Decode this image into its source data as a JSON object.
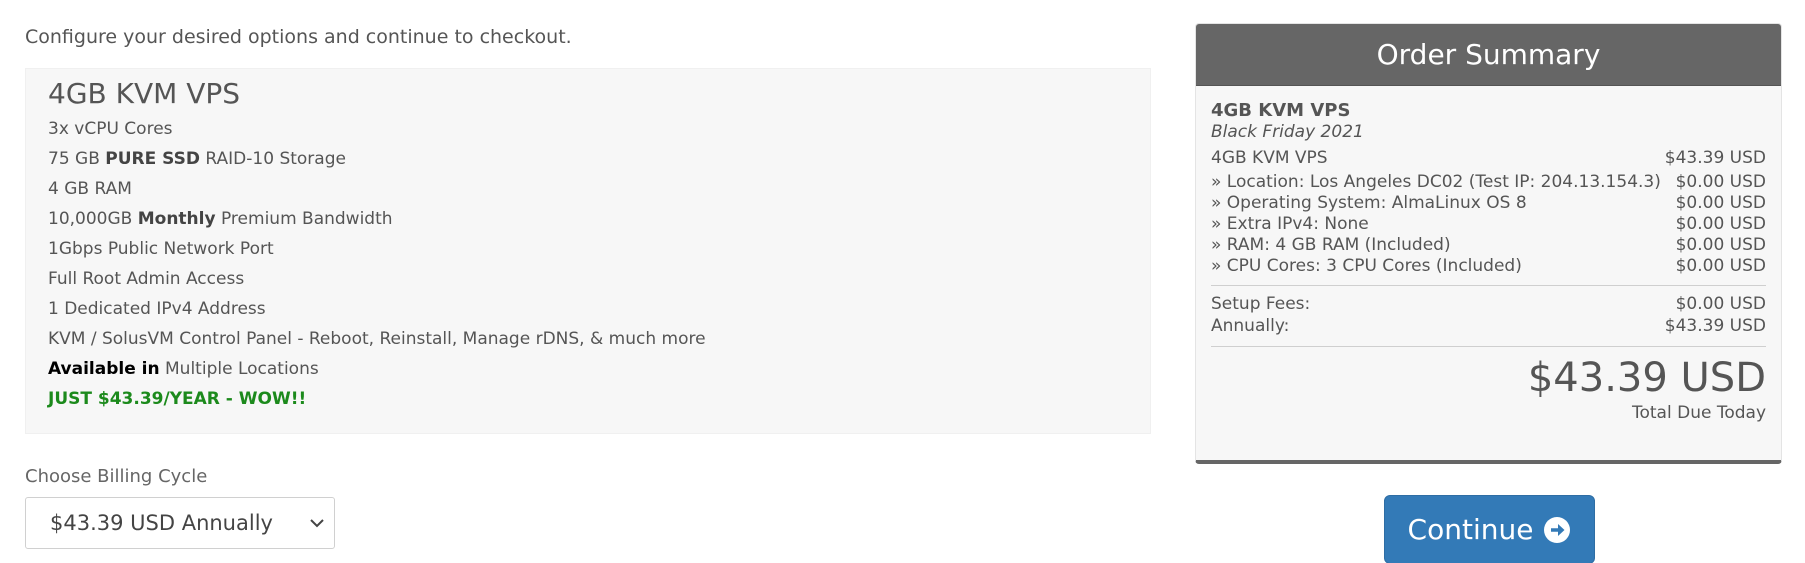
{
  "intro": "Configure your desired options and continue to checkout.",
  "product": {
    "title": "4GB KVM VPS",
    "features": [
      {
        "pre": "3x vCPU Cores",
        "bold": "",
        "post": ""
      },
      {
        "pre": "75 GB ",
        "bold": "PURE SSD",
        "post": " RAID-10 Storage"
      },
      {
        "pre": "4 GB RAM",
        "bold": "",
        "post": ""
      },
      {
        "pre": "10,000GB ",
        "bold": "Monthly",
        "post": " Premium Bandwidth"
      },
      {
        "pre": "1Gbps Public Network Port",
        "bold": "",
        "post": ""
      },
      {
        "pre": "Full Root Admin Access",
        "bold": "",
        "post": ""
      },
      {
        "pre": "1 Dedicated IPv4 Address",
        "bold": "",
        "post": ""
      },
      {
        "pre": "KVM / SolusVM Control Panel - Reboot, Reinstall, Manage rDNS, & much more",
        "bold": "",
        "post": ""
      },
      {
        "pre": "",
        "bold": "Available in",
        "post": " Multiple Locations"
      },
      {
        "pre": "JUST $43.39/YEAR - WOW!!",
        "bold": "",
        "post": ""
      }
    ],
    "promo_color": "#1c8a1c"
  },
  "billing": {
    "label": "Choose Billing Cycle",
    "selected": "$43.39 USD Annually",
    "icon": "chevron-down-icon"
  },
  "summary": {
    "title": "Order Summary",
    "product_name": "4GB KVM VPS",
    "product_group": "Black Friday 2021",
    "items": [
      {
        "label": "4GB KVM VPS",
        "amount": "$43.39 USD"
      },
      {
        "label": " » Location: Los Angeles DC02 (Test IP: 204.13.154.3)",
        "amount": "$0.00 USD"
      },
      {
        "label": " » Operating System: AlmaLinux OS 8",
        "amount": "$0.00 USD"
      },
      {
        "label": " » Extra IPv4: None",
        "amount": "$0.00 USD"
      },
      {
        "label": " » RAM: 4 GB RAM (Included)",
        "amount": "$0.00 USD"
      },
      {
        "label": " » CPU Cores: 3 CPU Cores (Included)",
        "amount": "$0.00 USD"
      }
    ],
    "setup_label": "Setup Fees:",
    "setup_amount": "$0.00 USD",
    "cycle_label": "Annually:",
    "cycle_amount": "$43.39 USD",
    "total": "$43.39 USD",
    "total_label": "Total Due Today",
    "header_color": "#666666"
  },
  "continue": {
    "label": "Continue",
    "icon": "arrow-circle-right-icon",
    "color": "#337ab7"
  }
}
